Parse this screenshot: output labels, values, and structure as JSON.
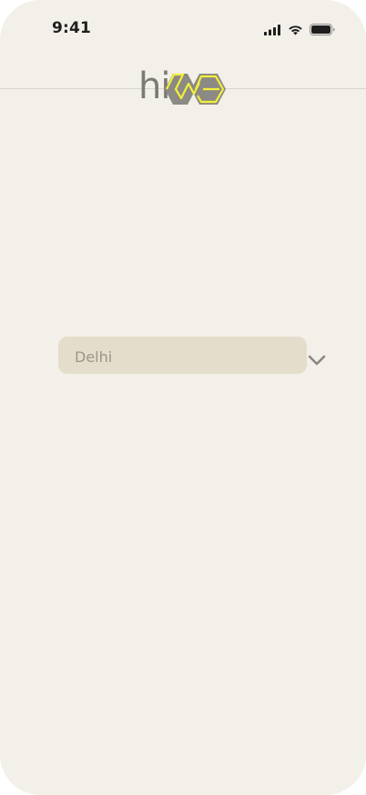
{
  "status_bar": {
    "time": "9:41",
    "icons": [
      "cellular-signal-icon",
      "wifi-icon",
      "battery-icon"
    ]
  },
  "header": {
    "logo_text": "hi",
    "logo_colors": {
      "text": "#7a7a76",
      "hex_fill": "#8c8a84",
      "outline": "#f2ee3c"
    }
  },
  "location_select": {
    "selected_value": "Delhi",
    "dropdown_icon": "chevron-down-icon"
  },
  "colors": {
    "background": "#f3f0e9",
    "select_background": "#e4ddcc",
    "select_text": "#9a958a",
    "chevron": "#8a8780",
    "divider": "#d7d3ca"
  }
}
